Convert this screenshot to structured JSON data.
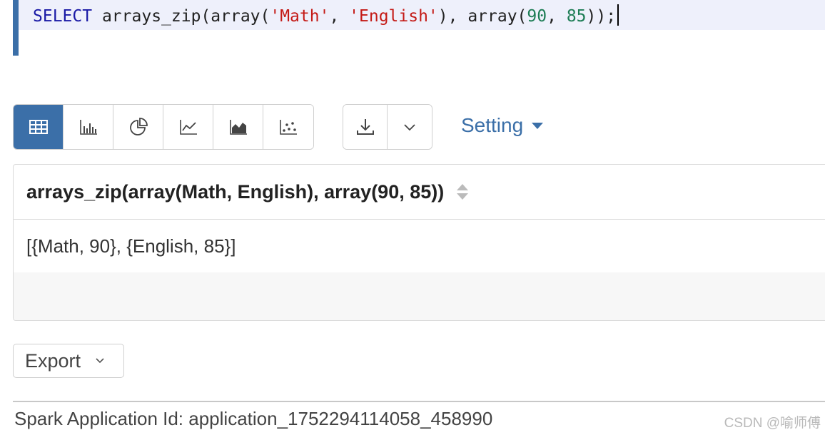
{
  "editor": {
    "tokens": {
      "kw": "SELECT",
      "fn1": "arrays_zip(array(",
      "s1": "'Math'",
      "sep1": ", ",
      "s2": "'English'",
      "mid": "), array(",
      "n1": "90",
      "sep2": ", ",
      "n2": "85",
      "end": "));"
    }
  },
  "toolbar": {
    "chart_types": [
      "table-icon",
      "bar-chart-icon",
      "pie-chart-icon",
      "line-chart-icon",
      "area-chart-icon",
      "scatter-chart-icon"
    ],
    "active": "table-icon",
    "setting_label": "Setting"
  },
  "result": {
    "column_header": "arrays_zip(array(Math, English), array(90, 85))",
    "rows": [
      "[{Math, 90}, {English, 85}]"
    ]
  },
  "export": {
    "label": "Export"
  },
  "footer": {
    "text": "Spark Application Id: application_1752294114058_458990"
  },
  "watermark": "CSDN @喻师傅",
  "colors": {
    "accent": "#3b6fa8",
    "keyword": "#1a1aa6",
    "string": "#c41a16",
    "number": "#1c7c54"
  }
}
